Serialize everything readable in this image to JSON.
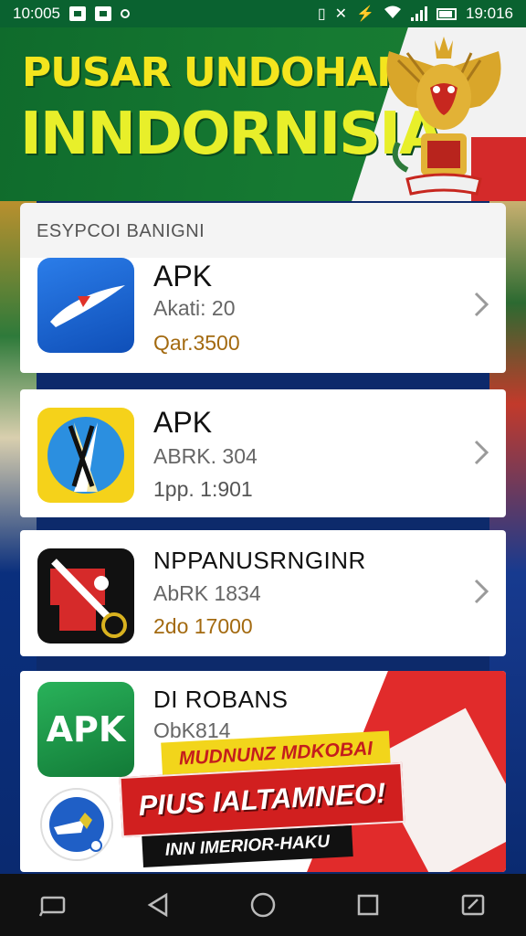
{
  "status_bar": {
    "time_left": "10:005",
    "time_right": "19:016"
  },
  "banner": {
    "title_line1": "PUSAR UNDOHAN",
    "title_line2": "INNDORNISIA"
  },
  "list": {
    "section_title": "ESYPCOI BANIGNI",
    "apps": [
      {
        "title": "APK",
        "subtitle": "Akati: 20",
        "price": "Qar.3500",
        "icon": "blue-orbit-icon",
        "accent": "#1565d8"
      },
      {
        "title": "APK",
        "subtitle": "ABRK. 304",
        "price": "1pp. 1:901",
        "icon": "yellow-compass-icon",
        "accent": "#f5d21a"
      },
      {
        "title": "NPPANUSRNGINR",
        "subtitle": "AbRK 1834",
        "price": "2do 17000",
        "icon": "red-flag-icon",
        "accent": "#111111"
      },
      {
        "title": "DI ROBANS",
        "subtitle": "ObK814",
        "price": "",
        "icon": "green-apk-icon",
        "accent": "#1f9a4a",
        "icon_text": "APK"
      }
    ]
  },
  "promo": {
    "tagline": "MUDNUNZ MDKOBAI",
    "headline": "PIUS IALTAMNEO!",
    "subline": "INN IMERIOR-HAKU"
  },
  "nav_bar": {
    "buttons": [
      "recent-apps-icon",
      "back-icon",
      "home-icon",
      "overview-icon",
      "screenshot-icon"
    ]
  }
}
